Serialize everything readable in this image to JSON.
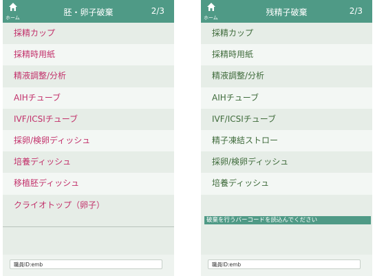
{
  "left": {
    "home_label": "ホーム",
    "title": "胚・卵子破棄",
    "page": "2/3",
    "items": [
      "採精カップ",
      "採精時用紙",
      "精液調整/分析",
      "AIHチューブ",
      "IVF/ICSIチューブ",
      "採卵/検卵ディッシュ",
      "培養ディッシュ",
      "移植胚ディッシュ",
      "クライオトップ（卵子）"
    ],
    "staff_id": "職員ID:emb"
  },
  "right": {
    "home_label": "ホーム",
    "title": "残精子破棄",
    "page": "2/3",
    "items": [
      "採精カップ",
      "採精時用紙",
      "精液調整/分析",
      "AIHチューブ",
      "IVF/ICSIチューブ",
      "精子凍結ストロー",
      "採卵/検卵ディッシュ",
      "培養ディッシュ"
    ],
    "notice": "破棄を行うバーコードを読込んでください",
    "staff_id": "職員ID:emb"
  },
  "colors": {
    "header": "#4f9a86",
    "left_item_text": "#c2306a",
    "right_item_text": "#3f6b3b"
  }
}
